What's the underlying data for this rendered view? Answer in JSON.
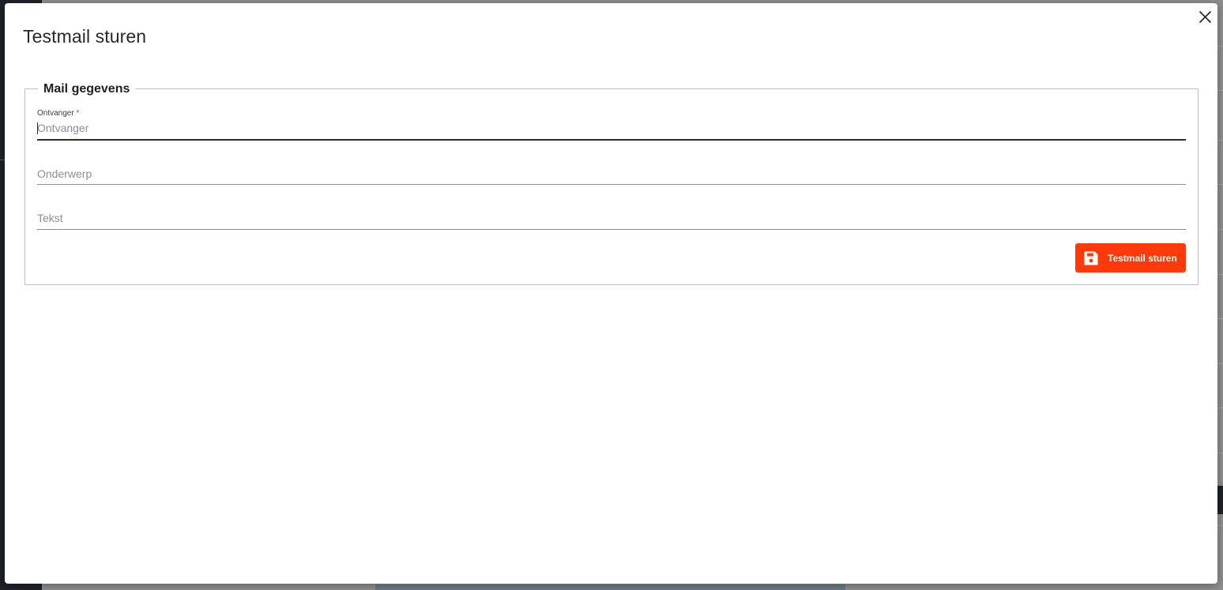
{
  "dialog": {
    "title": "Testmail sturen"
  },
  "fieldset": {
    "legend": "Mail gegevens",
    "fields": [
      {
        "label": "Ontvanger",
        "required_mark": "*",
        "value": "",
        "placeholder": "Ontvanger",
        "focused": true
      },
      {
        "label": "",
        "value": "",
        "placeholder": "Onderwerp",
        "focused": false
      },
      {
        "label": "",
        "value": "",
        "placeholder": "Tekst",
        "focused": false
      }
    ],
    "submit": {
      "label": "Testmail sturen",
      "icon": "save-icon"
    }
  },
  "colors": {
    "accent": "#ff3a0a",
    "required": "#e53935",
    "text": "#26292d"
  },
  "icons": [
    "close-icon",
    "save-icon"
  ]
}
